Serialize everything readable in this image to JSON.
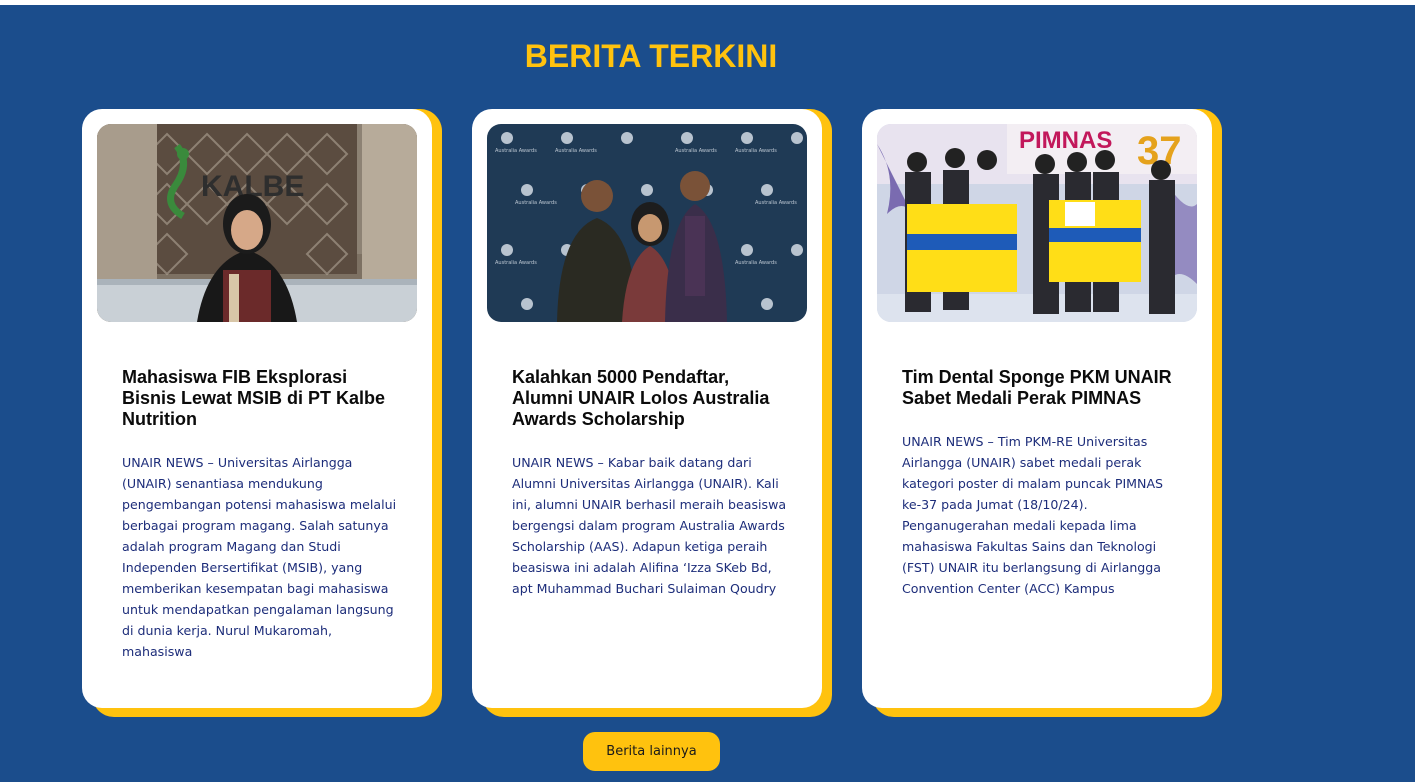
{
  "section": {
    "title": "BERITA TERKINI",
    "more_button_label": "Berita lainnya"
  },
  "colors": {
    "background": "#1b4d8c",
    "accent": "#ffc20e",
    "excerpt_text": "#1d2d7a"
  },
  "news": [
    {
      "image_alt": "Mahasiswi berhijab di depan logo KALBE",
      "image_logo_text": "KALBE",
      "title": "Mahasiswa FIB Eksplorasi Bisnis Lewat MSIB di PT Kalbe Nutrition",
      "excerpt": "UNAIR NEWS – Universitas Airlangga (UNAIR) senantiasa mendukung pengembangan potensi mahasiswa melalui berbagai program magang. Salah satunya adalah program Magang dan Studi Independen Bersertifikat (MSIB), yang memberikan kesempatan bagi mahasiswa untuk mendapatkan pengalaman langsung di dunia kerja. Nurul Mukaromah, mahasiswa"
    },
    {
      "image_alt": "Tiga peraih beasiswa di depan backdrop Australia Awards",
      "image_backdrop_text": "Australia Awards",
      "title": "Kalahkan 5000 Pendaftar, Alumni UNAIR Lolos Australia Awards Scholarship",
      "excerpt": "UNAIR NEWS – Kabar baik datang dari Alumni Universitas Airlangga (UNAIR). Kali ini, alumni UNAIR berhasil meraih beasiswa bergengsi dalam program Australia Awards Scholarship (AAS). Adapun ketiga peraih beasiswa ini adalah Alifina ‘Izza SKeb Bd, apt Muhammad Buchari Sulaiman Qoudry"
    },
    {
      "image_alt": "Tim mahasiswa membentangkan bendera kuning-biru di panggung PIMNAS 37",
      "image_banner_text": "PIMNAS",
      "image_banner_number": "37",
      "title": "Tim Dental Sponge PKM UNAIR Sabet Medali Perak PIMNAS",
      "excerpt": "UNAIR NEWS – Tim PKM-RE Universitas Airlangga (UNAIR) sabet medali perak kategori poster di malam puncak PIMNAS ke-37 pada Jumat (18/10/24). Penganugerahan medali kepada lima mahasiswa Fakultas Sains dan Teknologi (FST) UNAIR itu berlangsung di Airlangga Convention Center (ACC) Kampus"
    }
  ]
}
